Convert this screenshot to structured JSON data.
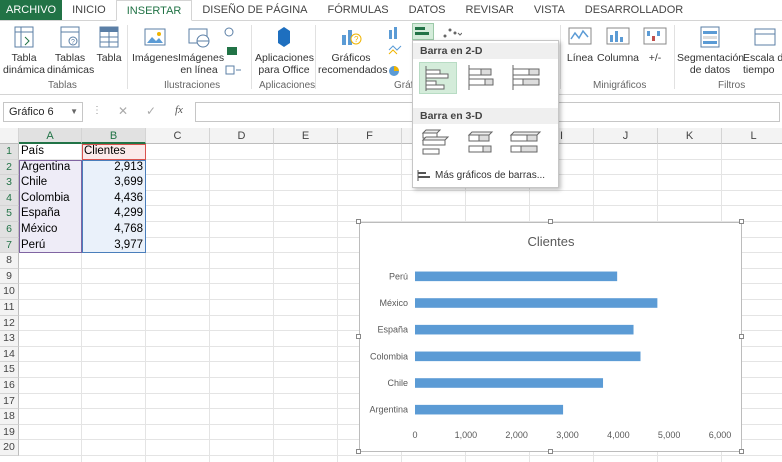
{
  "tabs": [
    "ARCHIVO",
    "INICIO",
    "INSERTAR",
    "DISEÑO DE PÁGINA",
    "FÓRMULAS",
    "DATOS",
    "REVISAR",
    "VISTA",
    "DESARROLLADOR"
  ],
  "ribbon": {
    "tabla_dinamica": "Tabla\ndinámica",
    "tablas_dinamicas": "Tablas\ndinámicas",
    "tabla": "Tabla",
    "grp_tablas": "Tablas",
    "imagenes": "Imágenes",
    "imagenes_linea": "Imágenes\nen línea",
    "grp_ilustraciones": "Ilustraciones",
    "aplicaciones_office": "Aplicaciones\npara Office",
    "grp_aplicaciones": "Aplicaciones",
    "graficos_recomendados": "Gráficos\nrecomendados",
    "grp_graficos": "Gráf",
    "linea": "Línea",
    "columna": "Columna",
    "ganancia": "+/-",
    "grp_minigraficos": "Minigráficos",
    "segmentacion": "Segmentación\nde datos",
    "escala": "Escala de\ntiempo",
    "grp_filtros": "Filtros"
  },
  "formula_bar": {
    "name_box": "Gráfico 6",
    "fx": "fx",
    "cancel": "✕",
    "confirm": "✓"
  },
  "columns": [
    "A",
    "B",
    "C",
    "D",
    "E",
    "F",
    "G",
    "H",
    "I",
    "J",
    "K",
    "L"
  ],
  "rows": [
    "1",
    "2",
    "3",
    "4",
    "5",
    "6",
    "7",
    "8",
    "9",
    "10",
    "11",
    "12",
    "13",
    "14",
    "15",
    "16",
    "17",
    "18",
    "19",
    "20"
  ],
  "table": {
    "header": [
      "País",
      "Clientes"
    ],
    "rows": [
      [
        "Argentina",
        "2,913"
      ],
      [
        "Chile",
        "3,699"
      ],
      [
        "Colombia",
        "4,436"
      ],
      [
        "España",
        "4,299"
      ],
      [
        "México",
        "4,768"
      ],
      [
        "Perú",
        "3,977"
      ]
    ]
  },
  "dropdown": {
    "section_2d": "Barra en 2-D",
    "section_3d": "Barra en 3-D",
    "more": "Más gráficos de barras..."
  },
  "colors": {
    "accent": "#217346",
    "bar": "#5b9bd5"
  },
  "chart_data": {
    "type": "bar",
    "orientation": "horizontal",
    "title": "Clientes",
    "categories": [
      "Argentina",
      "Chile",
      "Colombia",
      "España",
      "México",
      "Perú"
    ],
    "values": [
      2913,
      3699,
      4436,
      4299,
      4768,
      3977
    ],
    "xlim": [
      0,
      6000
    ],
    "xticks": [
      "0",
      "1,000",
      "2,000",
      "3,000",
      "4,000",
      "5,000",
      "6,000"
    ],
    "grid": false,
    "legend": "none"
  }
}
